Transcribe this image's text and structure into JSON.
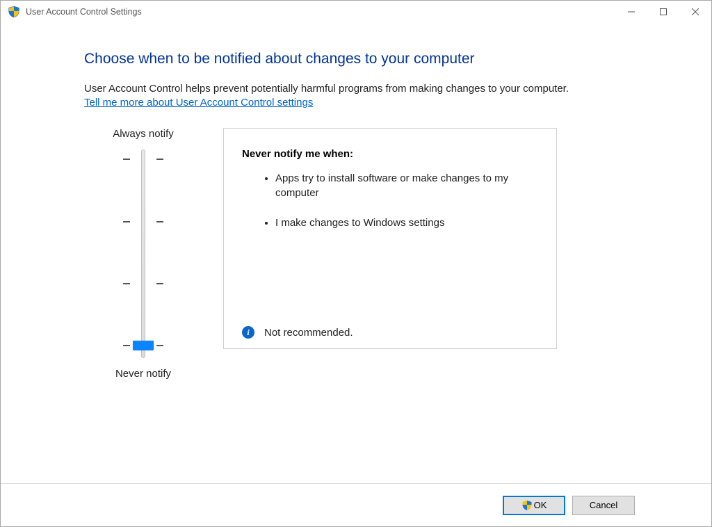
{
  "titlebar": {
    "title": "User Account Control Settings"
  },
  "content": {
    "heading": "Choose when to be notified about changes to your computer",
    "subtext": "User Account Control helps prevent potentially harmful programs from making changes to your computer.",
    "link_text": "Tell me more about User Account Control settings"
  },
  "slider": {
    "top_label": "Always notify",
    "bottom_label": "Never notify",
    "level_count": 4,
    "selected_level": 0
  },
  "description": {
    "heading": "Never notify me when:",
    "bullets": [
      "Apps try to install software or make changes to my computer",
      "I make changes to Windows settings"
    ],
    "status_text": "Not recommended."
  },
  "footer": {
    "ok_label": "OK",
    "cancel_label": "Cancel"
  }
}
